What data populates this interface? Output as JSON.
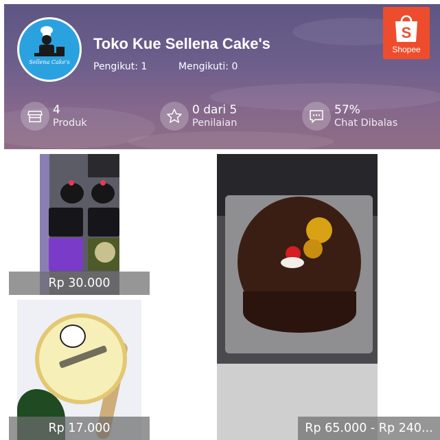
{
  "shop": {
    "name": "Toko Kue Sellena Cake's",
    "avatar_text": "Sellena Cake's",
    "followers": "Pengikut: 1",
    "following": "Mengikuti: 0"
  },
  "brand": {
    "name": "Shopee",
    "icon": "shopping-bag-s-icon",
    "color": "#ee4d2d"
  },
  "stats": [
    {
      "icon": "store-icon",
      "value": "4",
      "label": "Produk"
    },
    {
      "icon": "star-icon",
      "value": "0 dari 5",
      "label": "Penilaian"
    },
    {
      "icon": "chat-icon",
      "value": "57%",
      "label": "Chat Dibalas"
    }
  ],
  "products": [
    {
      "price": "Rp 30.000"
    },
    {
      "price": "Rp 17.000"
    },
    {
      "price": "Rp 65.000 - Rp 240..."
    }
  ]
}
